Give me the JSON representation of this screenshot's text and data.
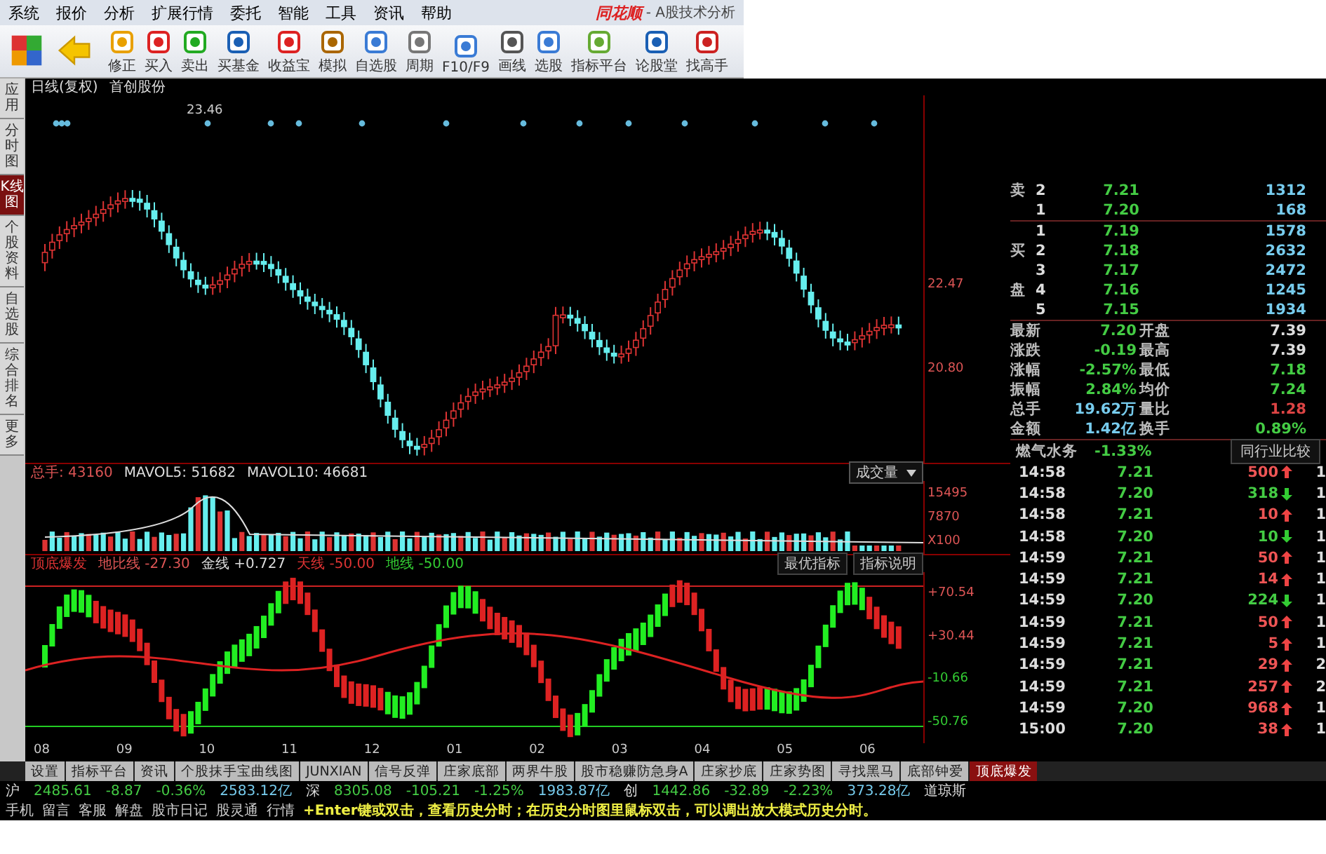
{
  "menu": {
    "items": [
      "系统",
      "报价",
      "分析",
      "扩展行情",
      "委托",
      "智能",
      "工具",
      "资讯",
      "帮助"
    ],
    "logo": "同花顺",
    "title": "- A股技术分析"
  },
  "toolbar": {
    "buttons": [
      "修正",
      "买入",
      "卖出",
      "买基金",
      "收益宝",
      "模拟",
      "自选股",
      "周期",
      "F10/F9",
      "画线",
      "选股",
      "指标平台",
      "论股堂",
      "找高手"
    ]
  },
  "side_tabs": [
    {
      "label": "应用",
      "selected": false
    },
    {
      "label": "分时图",
      "selected": false
    },
    {
      "label": "K线图",
      "selected": true
    },
    {
      "label": "个股资料",
      "selected": false
    },
    {
      "label": "自选股",
      "selected": false
    },
    {
      "label": "综合排名",
      "selected": false
    },
    {
      "label": "更多",
      "selected": false
    }
  ],
  "price_chart": {
    "period": "日线(复权)",
    "stock": "首创股份",
    "high_marker": "23.46",
    "y_labels": [
      "22.47",
      "20.80"
    ]
  },
  "volume_chart": {
    "total": "总手: 43160",
    "mavol5": "MAVOL5: 51682",
    "mavol10": "MAVOL10: 46681",
    "dropdown": "成交量",
    "y_labels": [
      "15495",
      "7870",
      "X100"
    ]
  },
  "indicator_chart": {
    "name": "顶底爆发",
    "line1": "地比线 -27.30",
    "line2": "金线 +0.727",
    "line3": "天线 -50.00",
    "line4": "地线 -50.00",
    "buttons": [
      "最优指标",
      "指标说明"
    ],
    "y_labels": [
      "+70.54",
      "+30.44",
      "-10.66",
      "-50.76"
    ]
  },
  "x_axis": [
    "08",
    "09",
    "10",
    "11",
    "12",
    "01",
    "02",
    "03",
    "04",
    "05",
    "06"
  ],
  "order_book": [
    {
      "side": "卖",
      "level": "2",
      "price": "7.21",
      "volume": "1312"
    },
    {
      "level": "1",
      "price": "7.20",
      "volume": "168"
    },
    {
      "level": "1",
      "price": "7.19",
      "volume": "1578"
    },
    {
      "side": "买",
      "level": "2",
      "price": "7.18",
      "volume": "2632"
    },
    {
      "level": "3",
      "price": "7.17",
      "volume": "2472"
    },
    {
      "side": "盘",
      "level": "4",
      "price": "7.16",
      "volume": "1245"
    },
    {
      "level": "5",
      "price": "7.15",
      "volume": "1934"
    }
  ],
  "stats": [
    {
      "label": "最新",
      "value": "7.20",
      "label2": "开盘",
      "value2": "7.39"
    },
    {
      "label": "涨跌",
      "value": "-0.19",
      "label2": "最高",
      "value2": "7.39"
    },
    {
      "label": "涨幅",
      "value": "-2.57%",
      "label2": "最低",
      "value2": "7.18"
    },
    {
      "label": "振幅",
      "value": "2.84%",
      "label2": "均价",
      "value2": "7.24"
    },
    {
      "label": "总手",
      "value": "19.62万",
      "label2": "量比",
      "value2": "1.28"
    },
    {
      "label": "金额",
      "value": "1.42亿",
      "label2": "换手",
      "value2": "0.89%"
    }
  ],
  "industry": {
    "name": "燃气水务",
    "change": "-1.33%",
    "button": "同行业比较"
  },
  "ticks": [
    {
      "time": "14:58",
      "price": "7.21",
      "volume": "500",
      "up": true,
      "column_5": "1"
    },
    {
      "time": "14:58",
      "price": "7.20",
      "volume": "318",
      "up": false,
      "column_5": "1"
    },
    {
      "time": "14:58",
      "price": "7.21",
      "volume": "10",
      "up": true,
      "column_5": "1"
    },
    {
      "time": "14:58",
      "price": "7.20",
      "volume": "10",
      "up": false,
      "column_5": "1"
    },
    {
      "time": "14:59",
      "price": "7.21",
      "volume": "50",
      "up": true,
      "column_5": "1"
    },
    {
      "time": "14:59",
      "price": "7.21",
      "volume": "14",
      "up": true,
      "column_5": "1"
    },
    {
      "time": "14:59",
      "price": "7.20",
      "volume": "224",
      "up": false,
      "column_5": "1"
    },
    {
      "time": "14:59",
      "price": "7.21",
      "volume": "50",
      "up": true,
      "column_5": "1"
    },
    {
      "time": "14:59",
      "price": "7.21",
      "volume": "5",
      "up": true,
      "column_5": "1"
    },
    {
      "time": "14:59",
      "price": "7.21",
      "volume": "29",
      "up": true,
      "column_5": "2"
    },
    {
      "time": "14:59",
      "price": "7.21",
      "volume": "257",
      "up": true,
      "column_5": "2"
    },
    {
      "time": "14:59",
      "price": "7.20",
      "volume": "968",
      "up": true,
      "column_5": "1"
    },
    {
      "time": "15:00",
      "price": "7.20",
      "volume": "38",
      "up": true,
      "column_5": "1"
    }
  ],
  "bottom_tabs": [
    {
      "label": "设置",
      "selected": false
    },
    {
      "label": "指标平台",
      "selected": false
    },
    {
      "label": "资讯",
      "selected": false
    },
    {
      "label": "个股抹手宝曲线图",
      "selected": false
    },
    {
      "label": "JUNXIAN",
      "selected": false
    },
    {
      "label": "信号反弹",
      "selected": false
    },
    {
      "label": "庄家底部",
      "selected": false
    },
    {
      "label": "两界牛股",
      "selected": false
    },
    {
      "label": "股市稳赚防急身A",
      "selected": false
    },
    {
      "label": "庄家抄底",
      "selected": false
    },
    {
      "label": "庄家势图",
      "selected": false
    },
    {
      "label": "寻找黑马",
      "selected": false
    },
    {
      "label": "底部钟爱",
      "selected": false
    },
    {
      "label": "顶底爆发",
      "selected": true
    }
  ],
  "ticker": [
    {
      "market": "沪",
      "index": "2485.61",
      "change": "-8.87",
      "percent": "-0.36%",
      "amount": "2583.12亿"
    },
    {
      "market": "深",
      "index": "8305.08",
      "change": "-105.21",
      "percent": "-1.25%",
      "amount": "1983.87亿"
    },
    {
      "market": "创",
      "index": "1442.86",
      "change": "-32.89",
      "percent": "-2.23%",
      "amount": "373.28亿"
    },
    {
      "market": "道琼斯"
    }
  ],
  "status_bar": {
    "items": [
      "手机",
      "留言",
      "客服",
      "解盘",
      "股市日记",
      "股灵通",
      "行情"
    ],
    "message": "+Enter键或双击，查看历史分时；在历史分时图里鼠标双击，可以调出放大模式历史分时。"
  }
}
